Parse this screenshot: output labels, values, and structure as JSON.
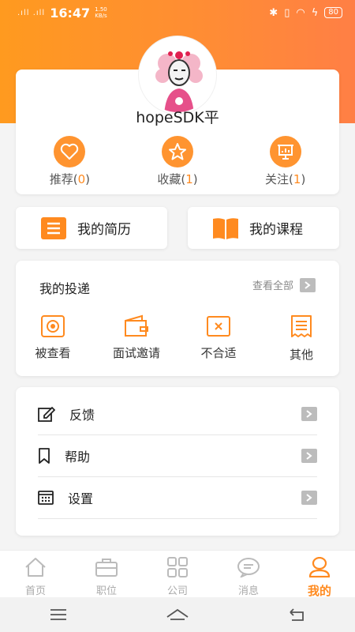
{
  "status_bar": {
    "time": "16:47",
    "speed_value": "1.50",
    "speed_unit": "KB/s",
    "battery": "80"
  },
  "profile": {
    "username": "hopeSDK平",
    "stats": [
      {
        "label": "推荐",
        "count": "0",
        "icon": "heart-icon"
      },
      {
        "label": "收藏",
        "count": "1",
        "icon": "star-icon"
      },
      {
        "label": "关注",
        "count": "1",
        "icon": "presentation-icon"
      }
    ]
  },
  "quick_actions": [
    {
      "label": "我的简历",
      "icon": "list-icon"
    },
    {
      "label": "我的课程",
      "icon": "book-icon"
    }
  ],
  "deliveries": {
    "title": "我的投递",
    "view_all": "查看全部",
    "items": [
      {
        "label": "被查看",
        "icon": "eye-box-icon"
      },
      {
        "label": "面试邀请",
        "icon": "wallet-icon"
      },
      {
        "label": "不合适",
        "icon": "x-box-icon"
      },
      {
        "label": "其他",
        "icon": "receipt-icon"
      }
    ]
  },
  "settings": [
    {
      "label": "反馈",
      "icon": "edit-icon"
    },
    {
      "label": "帮助",
      "icon": "bookmark-icon"
    },
    {
      "label": "设置",
      "icon": "calendar-icon"
    }
  ],
  "tabs": [
    {
      "label": "首页",
      "icon": "home-icon"
    },
    {
      "label": "职位",
      "icon": "briefcase-icon"
    },
    {
      "label": "公司",
      "icon": "grid-icon"
    },
    {
      "label": "消息",
      "icon": "chat-icon"
    },
    {
      "label": "我的",
      "icon": "user-icon",
      "active": true
    }
  ],
  "colors": {
    "accent": "#ff8a1f",
    "header_start": "#ff9a1f",
    "header_end": "#ff7f45"
  }
}
